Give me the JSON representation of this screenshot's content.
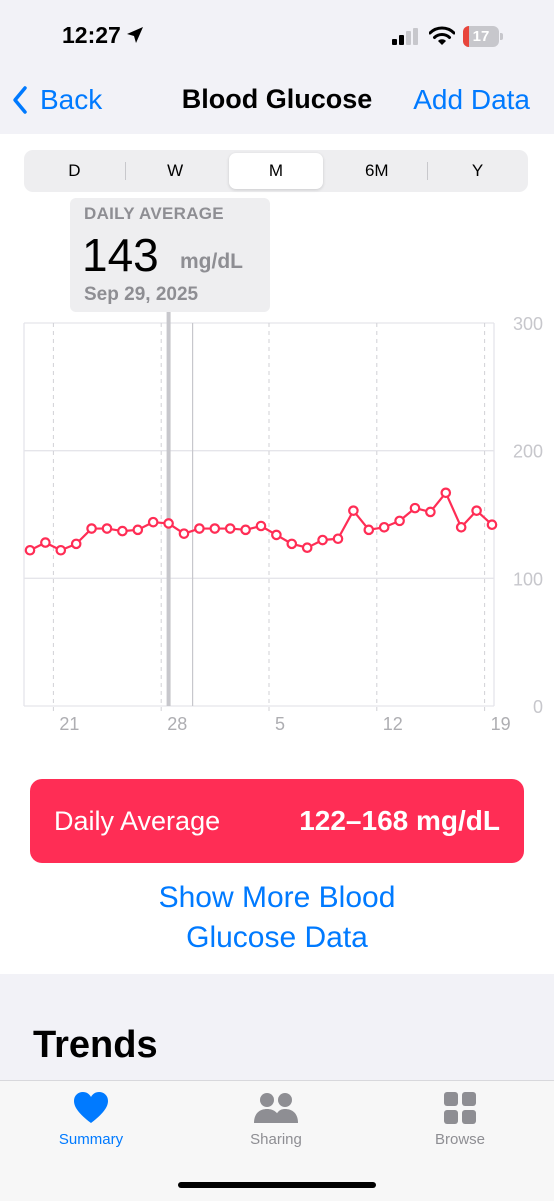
{
  "status_bar": {
    "time": "12:27",
    "battery_level": "17",
    "battery_fraction": 0.17,
    "icons": [
      "location-arrow-icon",
      "cellular-signal-icon",
      "wifi-icon",
      "battery-icon"
    ]
  },
  "nav": {
    "back_label": "Back",
    "title": "Blood Glucose",
    "add_label": "Add Data"
  },
  "segments": {
    "items": [
      "D",
      "W",
      "M",
      "6M",
      "Y"
    ],
    "selected": "M"
  },
  "tooltip": {
    "label": "DAILY AVERAGE",
    "value": "143",
    "unit": "mg/dL",
    "date": "Sep 29, 2025"
  },
  "chart_data": {
    "type": "line",
    "x_ticks": [
      "21",
      "28",
      "5",
      "12",
      "19"
    ],
    "y_ticks": [
      "0",
      "100",
      "200",
      "300"
    ],
    "ylim": [
      0,
      300
    ],
    "grid": true,
    "color": "#ff2d55",
    "series": [
      {
        "values": [
          122,
          128,
          122,
          127,
          139,
          139,
          137,
          138,
          144,
          143,
          135,
          139,
          139,
          139,
          138,
          141,
          134,
          127,
          124,
          130,
          131,
          153,
          138,
          140,
          145,
          155,
          152,
          167,
          140,
          153,
          142
        ]
      }
    ]
  },
  "range": {
    "label": "Daily Average",
    "value": "122–168 mg/dL"
  },
  "show_more": {
    "line1": "Show More Blood",
    "line2": "Glucose Data"
  },
  "trends": {
    "title": "Trends"
  },
  "tab_bar": {
    "tabs": [
      {
        "label": "Summary",
        "icon": "heart-icon",
        "active": true
      },
      {
        "label": "Sharing",
        "icon": "people-icon",
        "active": false
      },
      {
        "label": "Browse",
        "icon": "grid-icon",
        "active": false
      }
    ]
  }
}
